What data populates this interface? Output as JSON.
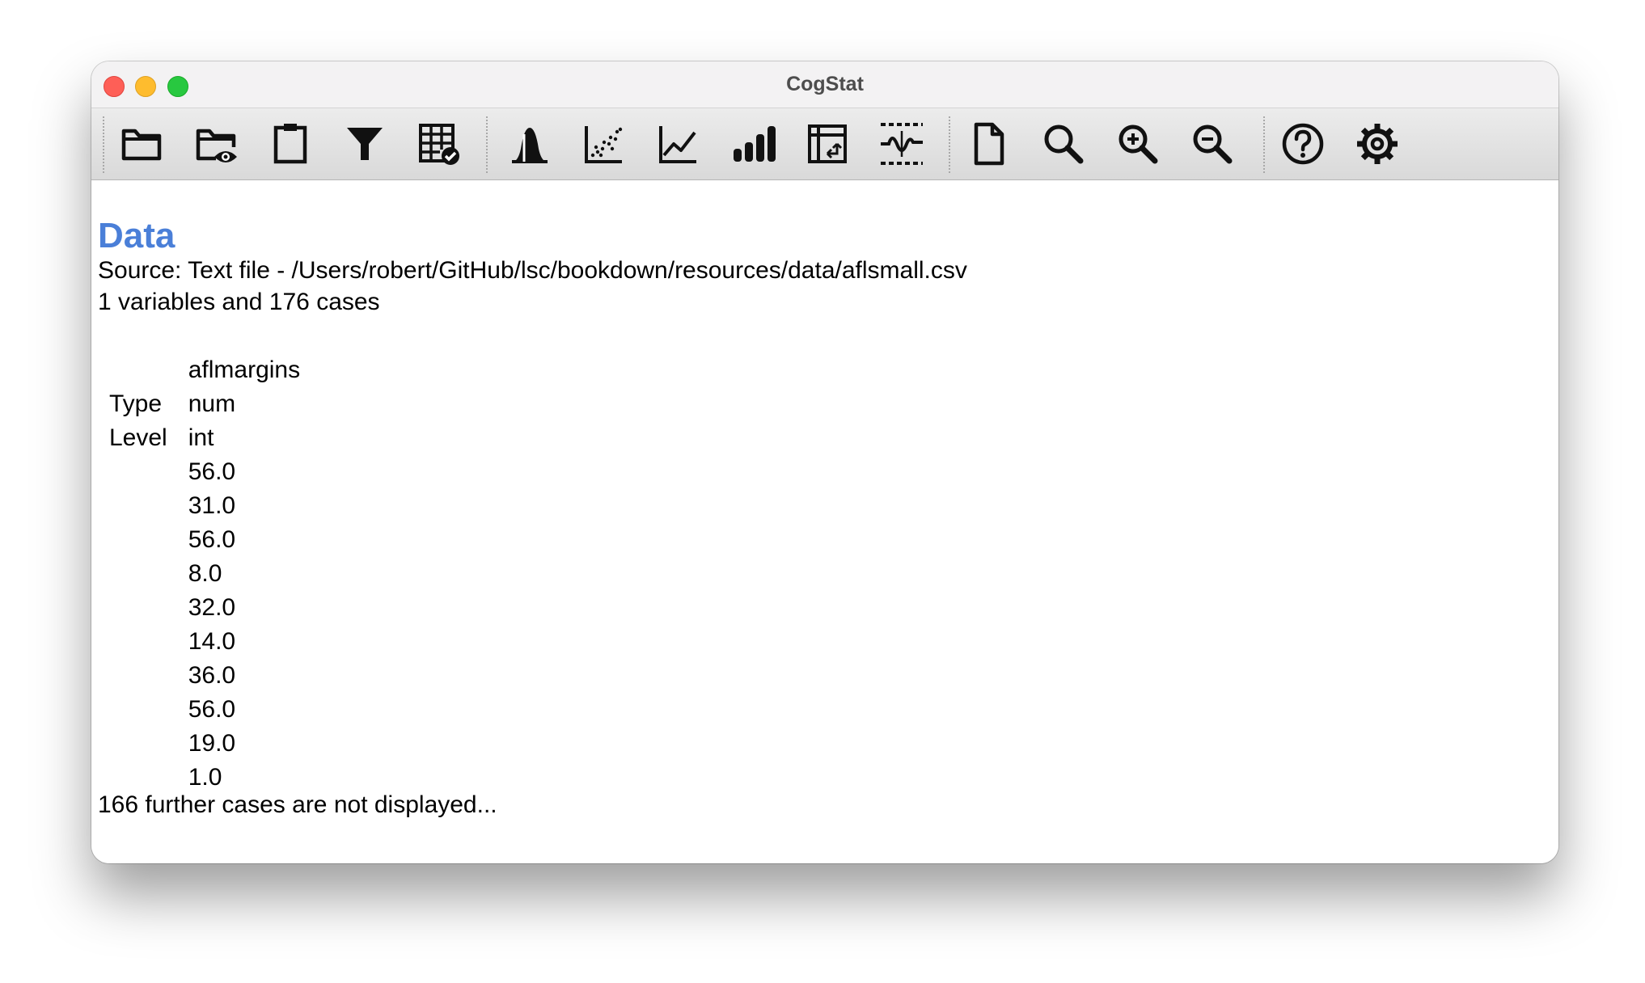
{
  "window": {
    "title": "CogStat"
  },
  "toolbar": {
    "icons": [
      "open-folder-icon",
      "view-data-icon",
      "clipboard-icon",
      "filter-icon",
      "data-table-check-icon",
      "distribution-icon",
      "scatter-icon",
      "line-chart-icon",
      "bar-chart-icon",
      "pivot-table-icon",
      "compare-groups-icon",
      "new-document-icon",
      "search-icon",
      "zoom-in-icon",
      "zoom-out-icon",
      "help-icon",
      "settings-icon"
    ]
  },
  "content": {
    "heading": "Data",
    "source": "Source: Text file - /Users/robert/GitHub/lsc/bookdown/resources/data/aflsmall.csv",
    "summary": "1 variables and 176 cases",
    "table": {
      "variable": "aflmargins",
      "type_label": "Type",
      "type_value": "num",
      "level_label": "Level",
      "level_value": "int",
      "values": [
        "56.0",
        "31.0",
        "56.0",
        "8.0",
        "32.0",
        "14.0",
        "36.0",
        "56.0",
        "19.0",
        "1.0"
      ]
    },
    "footer": "166 further cases are not displayed..."
  }
}
